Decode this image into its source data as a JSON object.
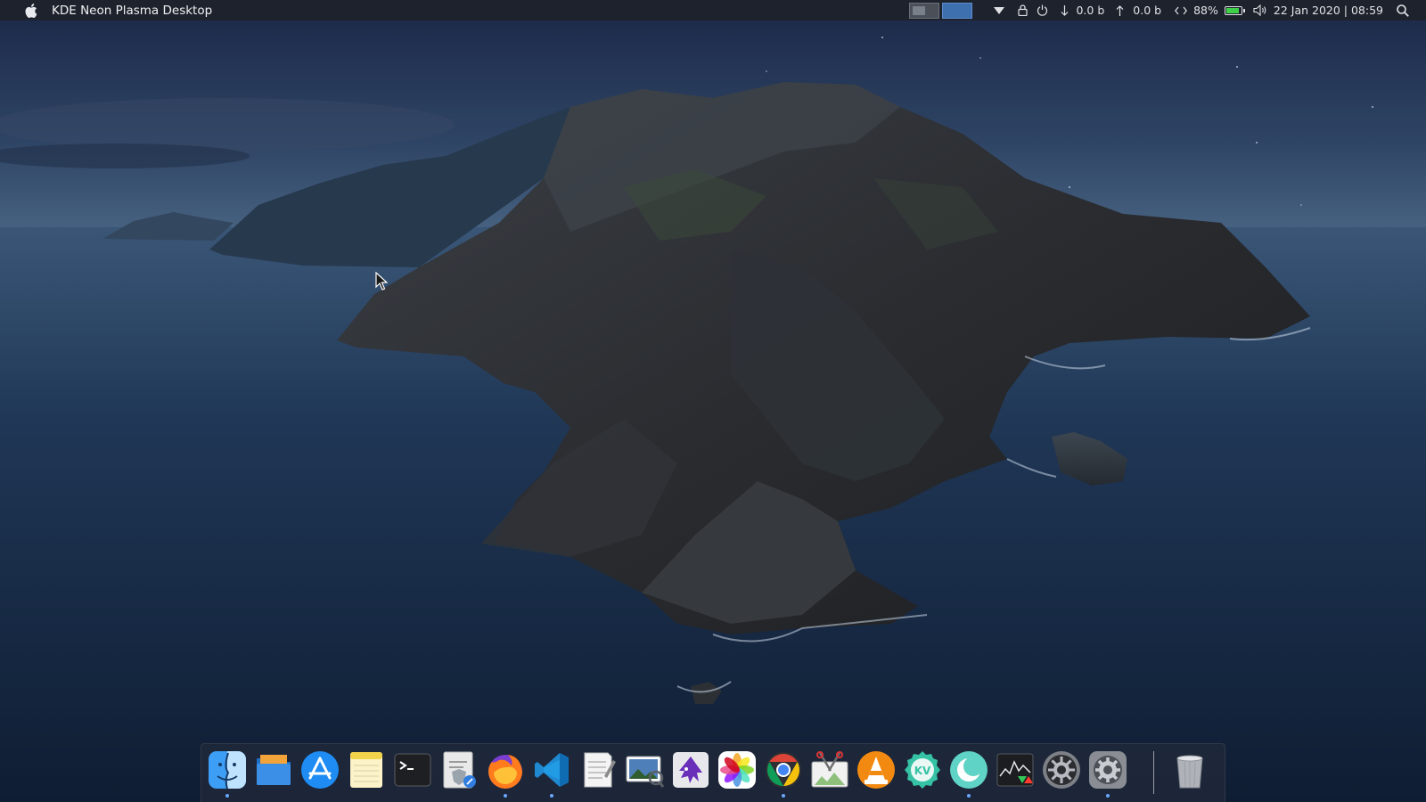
{
  "topbar": {
    "apple_icon": "apple-icon",
    "app_title": "KDE Neon Plasma Desktop",
    "net_down": "0.0 b",
    "net_up": "0.0 b",
    "battery_percent": "88%",
    "battery_level": 0.88,
    "datetime": "22 Jan 2020 | 08:59"
  },
  "colors": {
    "panel": "#1e222a",
    "accent": "#3e6fae",
    "battery": "#3fd04a"
  },
  "dock": {
    "items": [
      {
        "icon": "finder-icon",
        "running": true
      },
      {
        "icon": "files-folder-icon",
        "running": false
      },
      {
        "icon": "app-store-icon",
        "running": false
      },
      {
        "icon": "notes-icon",
        "running": false
      },
      {
        "icon": "terminal-icon",
        "running": false
      },
      {
        "icon": "script-editor-icon",
        "running": false
      },
      {
        "icon": "firefox-icon",
        "running": true
      },
      {
        "icon": "vscode-icon",
        "running": true
      },
      {
        "icon": "text-editor-icon",
        "running": false
      },
      {
        "icon": "image-viewer-icon",
        "running": false
      },
      {
        "icon": "inkscape-icon",
        "running": false
      },
      {
        "icon": "photos-icon",
        "running": false
      },
      {
        "icon": "chrome-icon",
        "running": true
      },
      {
        "icon": "screenshot-tool-icon",
        "running": false
      },
      {
        "icon": "vlc-icon",
        "running": false
      },
      {
        "icon": "kvantum-icon",
        "running": false
      },
      {
        "icon": "night-color-icon",
        "running": true
      },
      {
        "icon": "system-monitor-icon",
        "running": false
      },
      {
        "icon": "system-settings-icon",
        "running": false
      },
      {
        "icon": "system-preferences-icon",
        "running": true
      }
    ],
    "trash_icon": "trash-icon"
  }
}
